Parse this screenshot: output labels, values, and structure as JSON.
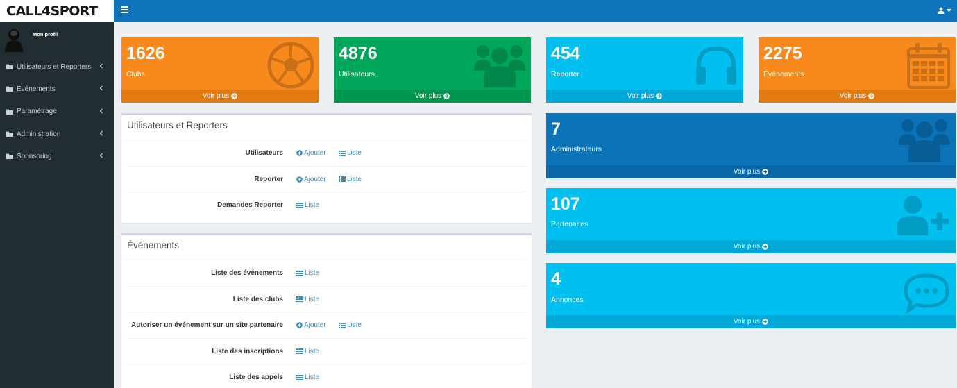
{
  "brand": {
    "logo_text": "CALL4SPORT"
  },
  "topbar": {
    "menu_icon": "bars-icon",
    "user_icon": "user-icon"
  },
  "sidebar": {
    "profile_label": "Mon profil",
    "items": [
      {
        "label": "Utilisateurs et Reporters"
      },
      {
        "label": "Événements"
      },
      {
        "label": "Paramétrage"
      },
      {
        "label": "Administration"
      },
      {
        "label": "Sponsoring"
      }
    ]
  },
  "more_label": "Voir plus",
  "stats": {
    "clubs": {
      "value": "1626",
      "label": "Clubs",
      "icon": "soccer-ball-icon",
      "color": "#f7891d"
    },
    "users": {
      "value": "4876",
      "label": "Utilisateurs",
      "icon": "users-icon",
      "color": "#00a65a"
    },
    "reporter": {
      "value": "454",
      "label": "Reporter",
      "icon": "headphones-icon",
      "color": "#00c0ef"
    },
    "events": {
      "value": "2275",
      "label": "Événements",
      "icon": "calendar-icon",
      "color": "#f7891d"
    },
    "admins": {
      "value": "7",
      "label": "Administrateurs",
      "icon": "users-icon",
      "color": "#0b73b8"
    },
    "partners": {
      "value": "107",
      "label": "Partenaires",
      "icon": "user-plus-icon",
      "color": "#00c0ef"
    },
    "ads": {
      "value": "4",
      "label": "Annonces",
      "icon": "comment-icon",
      "color": "#00c0ef"
    }
  },
  "users_panel": {
    "title": "Utilisateurs et Reporters",
    "rows": [
      {
        "label": "Utilisateurs",
        "add": "Ajouter",
        "list": "Liste"
      },
      {
        "label": "Reporter",
        "add": "Ajouter",
        "list": "Liste"
      },
      {
        "label": "Demandes Reporter",
        "list": "Liste"
      }
    ]
  },
  "events_panel": {
    "title": "Événements",
    "rows": [
      {
        "label": "Liste des événements",
        "list": "Liste"
      },
      {
        "label": "Liste des clubs",
        "list": "Liste"
      },
      {
        "label": "Autoriser un événement sur un site partenaire",
        "add": "Ajouter",
        "list": "Liste"
      },
      {
        "label": "Liste des inscriptions",
        "list": "Liste"
      },
      {
        "label": "Liste des appels",
        "list": "Liste"
      }
    ]
  }
}
